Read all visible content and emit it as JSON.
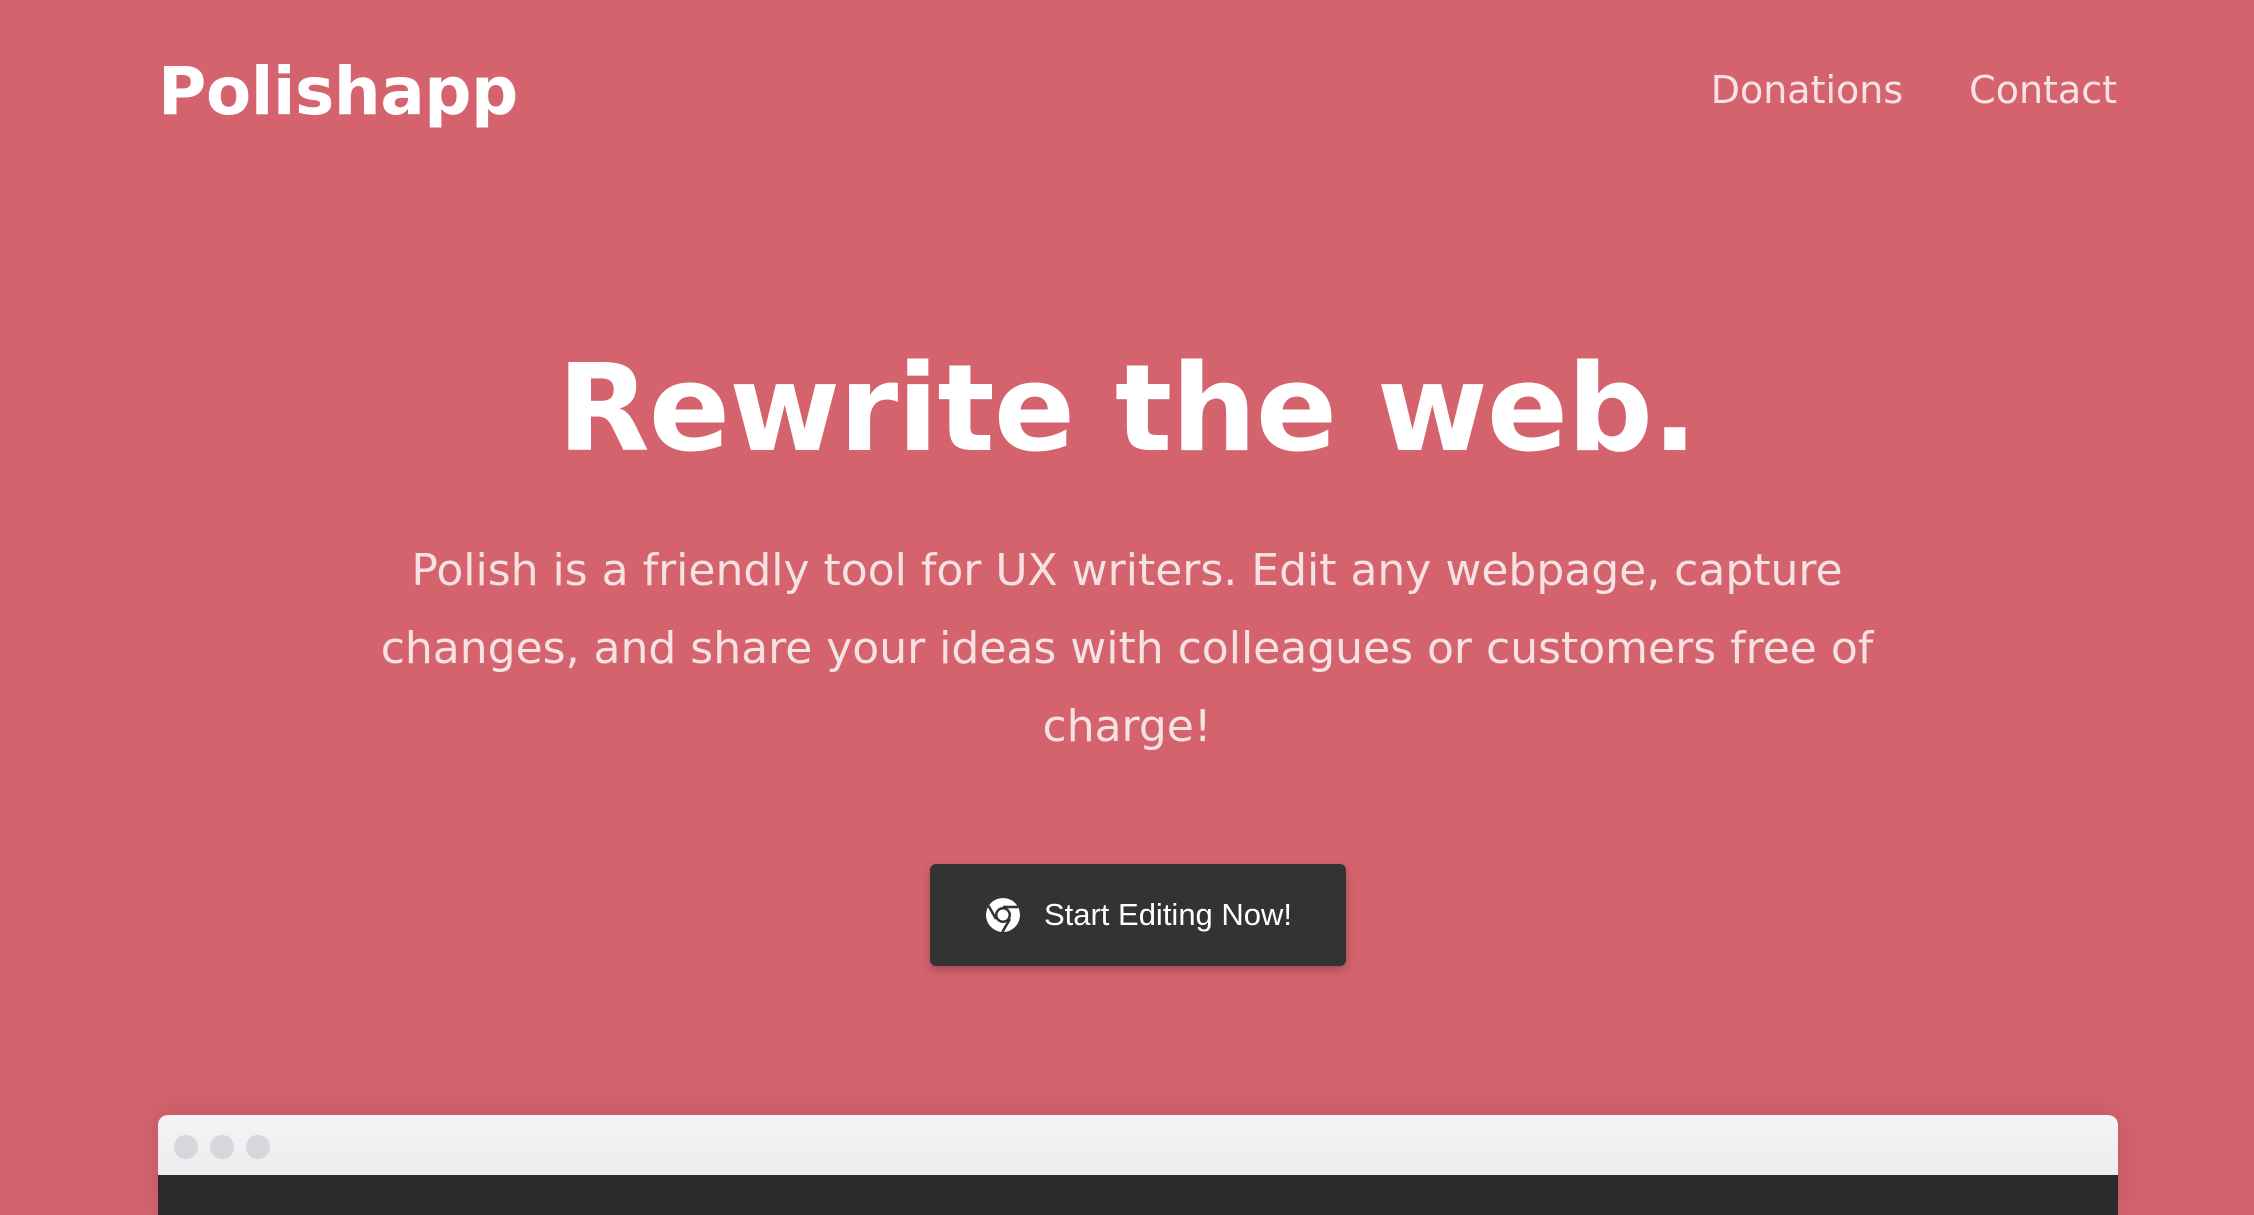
{
  "brand": {
    "name": "Polishapp"
  },
  "nav": {
    "items": [
      {
        "label": "Donations"
      },
      {
        "label": "Contact"
      }
    ]
  },
  "hero": {
    "title": "Rewrite the web.",
    "subtitle": "Polish is a friendly tool for UX writers. Edit any webpage, capture changes, and share your ideas with colleagues or customers free of charge!"
  },
  "cta": {
    "label": "Start Editing Now!",
    "icon": "chrome-icon"
  },
  "colors": {
    "background": "#d5636e",
    "button": "#333333",
    "text": "#ffffff"
  }
}
